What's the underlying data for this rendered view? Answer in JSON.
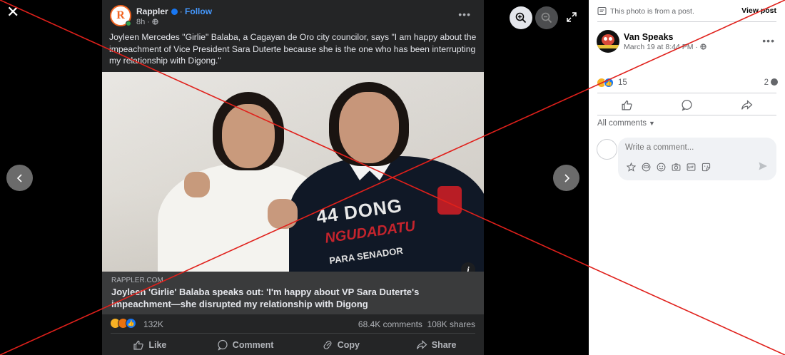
{
  "viewer": {
    "close_glyph": "✕",
    "icons": [
      "close-icon",
      "chevron-left-icon",
      "chevron-right-icon",
      "zoom-in-icon",
      "zoom-out-icon",
      "expand-icon"
    ]
  },
  "shared_post": {
    "page_name": "Rappler",
    "follow_label": "Follow",
    "time": "8h",
    "avatar_letter": "R",
    "text": "Joyleen Mercedes \"Girlie\" Balaba, a Cagayan de Oro city councilor, says \"I am happy about the impeachment of Vice President Sara Duterte because she is the one who has been interrupting my relationship with Digong.\"",
    "photo_shirt_line1": "44 DONG",
    "photo_shirt_line2": "NGUDADATU",
    "photo_shirt_line3": "PARA SENADOR",
    "link_domain": "RAPPLER.COM",
    "link_title": "Joyleen 'Girlie' Balaba speaks out: 'I'm happy about VP Sara Duterte's impeachment—she disrupted my relationship with Digong",
    "reaction_count": "132K",
    "comments": "68.4K comments",
    "shares": "108K shares",
    "actions": {
      "like": "Like",
      "comment": "Comment",
      "copy": "Copy",
      "share": "Share"
    }
  },
  "sidebar": {
    "note": "This photo is from a post.",
    "view_post": "View post",
    "author": "Van Speaks",
    "date": "March 19 at 8:44 PM",
    "reaction_count": "15",
    "comment_count": "2",
    "all_comments": "All comments",
    "comment_placeholder": "Write a comment..."
  },
  "colors": {
    "accent": "#1877f2",
    "overlay_line": "#e0201b",
    "dark_surface": "#242526"
  }
}
